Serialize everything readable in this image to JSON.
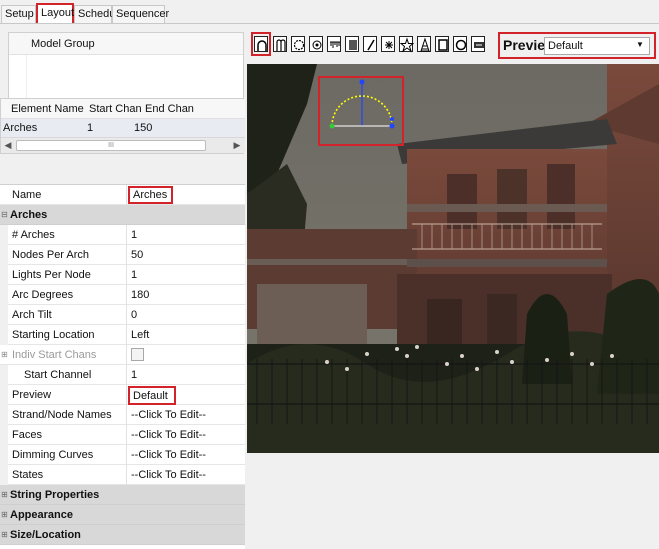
{
  "tabs": [
    {
      "label": "Setup",
      "active": false
    },
    {
      "label": "Layout",
      "active": true
    },
    {
      "label": "Schedule",
      "active": false
    },
    {
      "label": "Sequencer",
      "active": false
    }
  ],
  "model_group": {
    "header": "Model Group"
  },
  "element_table": {
    "columns": [
      "Element Name",
      "Start Chan",
      "End Chan"
    ],
    "row": {
      "name": "Arches",
      "start": "1",
      "end": "150"
    },
    "scroll_thumb": "III"
  },
  "properties": {
    "name_label": "Name",
    "name_value": "Arches",
    "category_arches": "Arches",
    "rows": [
      {
        "label": "# Arches",
        "value": "1"
      },
      {
        "label": "Nodes Per Arch",
        "value": "50"
      },
      {
        "label": "Lights Per Node",
        "value": "1"
      },
      {
        "label": "Arc Degrees",
        "value": "180"
      },
      {
        "label": "Arch Tilt",
        "value": "0"
      },
      {
        "label": "Starting Location",
        "value": "Left"
      }
    ],
    "indiv_start_chans_label": "Indiv Start Chans",
    "start_channel_label": "Start Channel",
    "start_channel_value": "1",
    "preview_label": "Preview",
    "preview_value": "Default",
    "edit_rows": [
      {
        "label": "Strand/Node Names",
        "value": "--Click To Edit--"
      },
      {
        "label": "Faces",
        "value": "--Click To Edit--"
      },
      {
        "label": "Dimming Curves",
        "value": "--Click To Edit--"
      },
      {
        "label": "States",
        "value": "--Click To Edit--"
      }
    ],
    "categories": [
      "String Properties",
      "Appearance",
      "Size/Location"
    ]
  },
  "toolbar": {
    "icons": [
      "arch-icon",
      "candy-cane-icon",
      "circle-icon",
      "dmx-icon",
      "icicles-icon",
      "matrix-icon",
      "single-line-icon",
      "poly-line-icon",
      "star-icon",
      "tree-icon",
      "window-frame-icon",
      "wreath-icon",
      "image-icon"
    ],
    "preview_label": "Preview:",
    "preview_value": "Default"
  },
  "colors": {
    "highlight": "#d2232a",
    "selected_arch": "#ffff00",
    "node_start": "#33cc33",
    "node_end": "#2244ff"
  }
}
